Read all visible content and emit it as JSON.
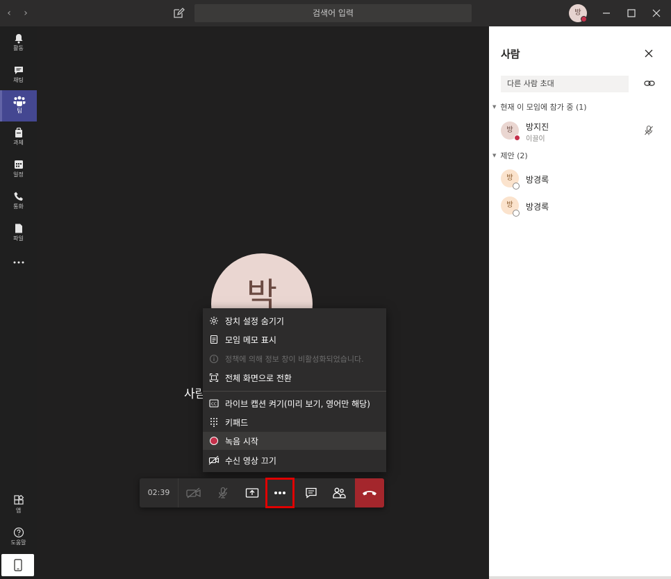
{
  "titlebar": {
    "search_placeholder": "검색어 입력",
    "user_initial": "방",
    "status_color": "#c4314b"
  },
  "rail": {
    "items": [
      {
        "label": "활동",
        "icon": "bell-icon"
      },
      {
        "label": "채팅",
        "icon": "chat-icon"
      },
      {
        "label": "팀",
        "icon": "teams-icon"
      },
      {
        "label": "과제",
        "icon": "assignments-icon"
      },
      {
        "label": "일정",
        "icon": "calendar-icon"
      },
      {
        "label": "통화",
        "icon": "phone-icon"
      },
      {
        "label": "파일",
        "icon": "file-icon"
      },
      {
        "label": "",
        "icon": "more-icon"
      }
    ],
    "bottom": [
      {
        "label": "앱",
        "icon": "apps-icon"
      },
      {
        "label": "도움말",
        "icon": "help-icon"
      }
    ]
  },
  "stage": {
    "avatar_initial": "박",
    "name_fragment": "사람"
  },
  "menu": {
    "items": [
      {
        "label": "장치 설정 숨기기",
        "icon": "gear-icon"
      },
      {
        "label": "모임 메모 표시",
        "icon": "notes-icon"
      },
      {
        "label": "정책에 의해 정보 창이 비활성화되었습니다.",
        "icon": "info-icon"
      },
      {
        "label": "전체 화면으로 전환",
        "icon": "fullscreen-icon"
      },
      {
        "label": "라이브 캡션 켜기(미리 보기, 영어만 해당)",
        "icon": "captions-icon"
      },
      {
        "label": "키패드",
        "icon": "keypad-icon"
      },
      {
        "label": "녹음 시작",
        "icon": "record-icon"
      },
      {
        "label": "수신 영상 끄기",
        "icon": "video-off-icon"
      }
    ]
  },
  "toolbar": {
    "timer": "02:39",
    "hangup_color": "#a4262c"
  },
  "panel": {
    "title": "사람",
    "invite_placeholder": "다른 사람 초대",
    "section_current": "현재 이 모임에 참가 중 (1)",
    "section_suggested": "제안 (2)",
    "current": [
      {
        "initial": "방",
        "name": "방지진",
        "sub": "이끌이"
      }
    ],
    "suggested": [
      {
        "initial": "방",
        "name": "방경록"
      },
      {
        "initial": "방",
        "name": "방경록"
      }
    ]
  }
}
